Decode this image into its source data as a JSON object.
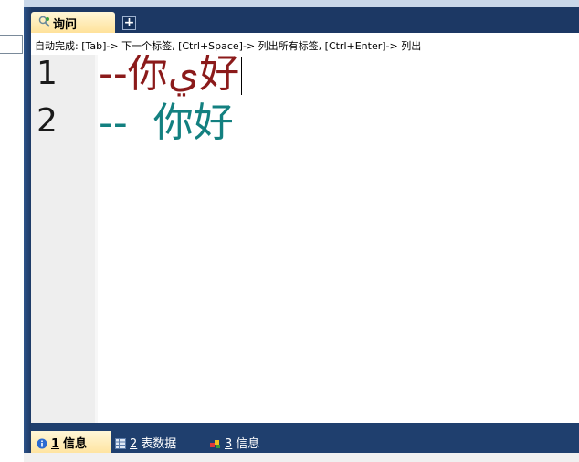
{
  "query_tab": {
    "label": "询问",
    "add_label": "+"
  },
  "hint": "自动完成: [Tab]-> 下一个标签, [Ctrl+Space]-> 列出所有标签, [Ctrl+Enter]-> 列出",
  "editor": {
    "lines": [
      {
        "number": "1",
        "text": "--你ي好"
      },
      {
        "number": "2",
        "text": "--  你好"
      }
    ]
  },
  "bottom_tabs": [
    {
      "num": "1",
      "label": "信息",
      "icon": "info-icon"
    },
    {
      "num": "2",
      "label": "表数据",
      "icon": "grid-icon"
    },
    {
      "num": "3",
      "label": "信息",
      "icon": "blocks-icon"
    }
  ],
  "colors": {
    "line1": "#8b1a1a",
    "line2": "#138080",
    "tab_active": "#ffe29a",
    "chrome": "#1f3f6e"
  }
}
